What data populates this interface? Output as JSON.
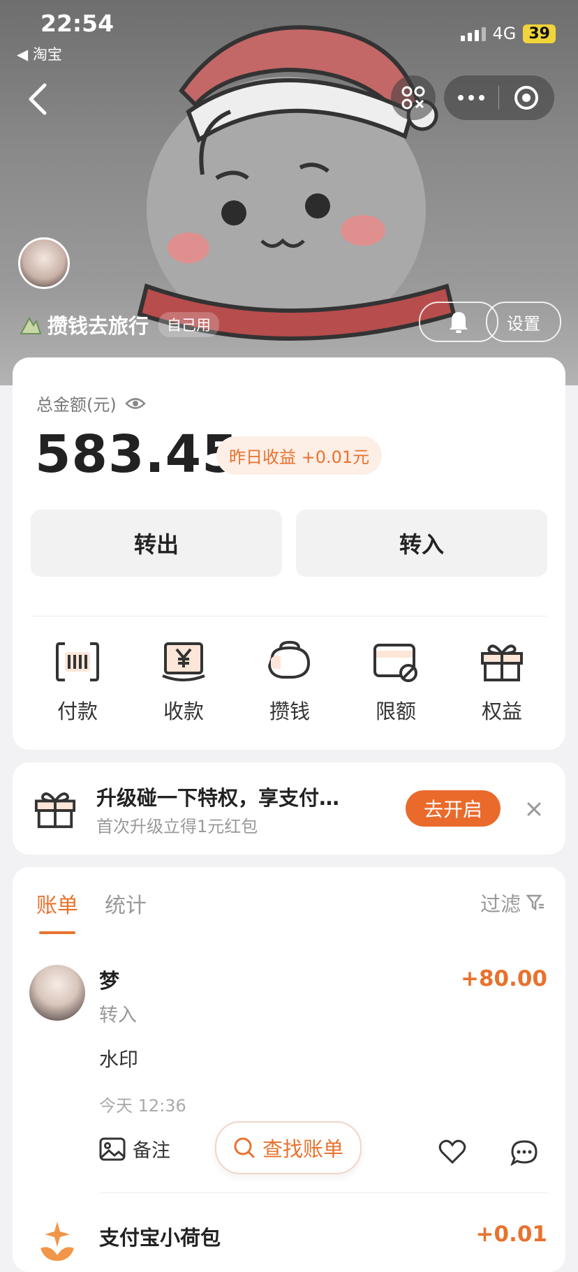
{
  "status": {
    "time": "22:54",
    "back_app": "◀ 淘宝",
    "network": "4G",
    "battery": "39"
  },
  "header": {
    "title": "攒钱去旅行",
    "tag": "自己用",
    "settings_label": "设置"
  },
  "balance": {
    "label": "总金额(元)",
    "amount": "583.45",
    "yield": "昨日收益 +0.01元",
    "transfer_out": "转出",
    "transfer_in": "转入"
  },
  "actions": [
    {
      "label": "付款",
      "icon": "barcode-pay-icon"
    },
    {
      "label": "收款",
      "icon": "yuan-receive-icon"
    },
    {
      "label": "攒钱",
      "icon": "piggy-bank-icon"
    },
    {
      "label": "限额",
      "icon": "card-limit-icon"
    },
    {
      "label": "权益",
      "icon": "gift-icon"
    }
  ],
  "promo": {
    "title": "升级碰一下特权，享支付…",
    "subtitle": "首次升级立得1元红包",
    "button": "去开启"
  },
  "bills": {
    "tab_active": "账单",
    "tab_stats": "统计",
    "filter": "过滤",
    "search": "查找账单",
    "items": [
      {
        "name": "梦",
        "type": "转入",
        "amount": "+80.00",
        "memo": "水印",
        "time": "今天 12:36",
        "note": "备注"
      },
      {
        "name": "支付宝小荷包",
        "amount": "+0.01"
      }
    ]
  },
  "colors": {
    "accent": "#e8722e",
    "card": "#ffffff",
    "background": "#f2f2f5"
  }
}
